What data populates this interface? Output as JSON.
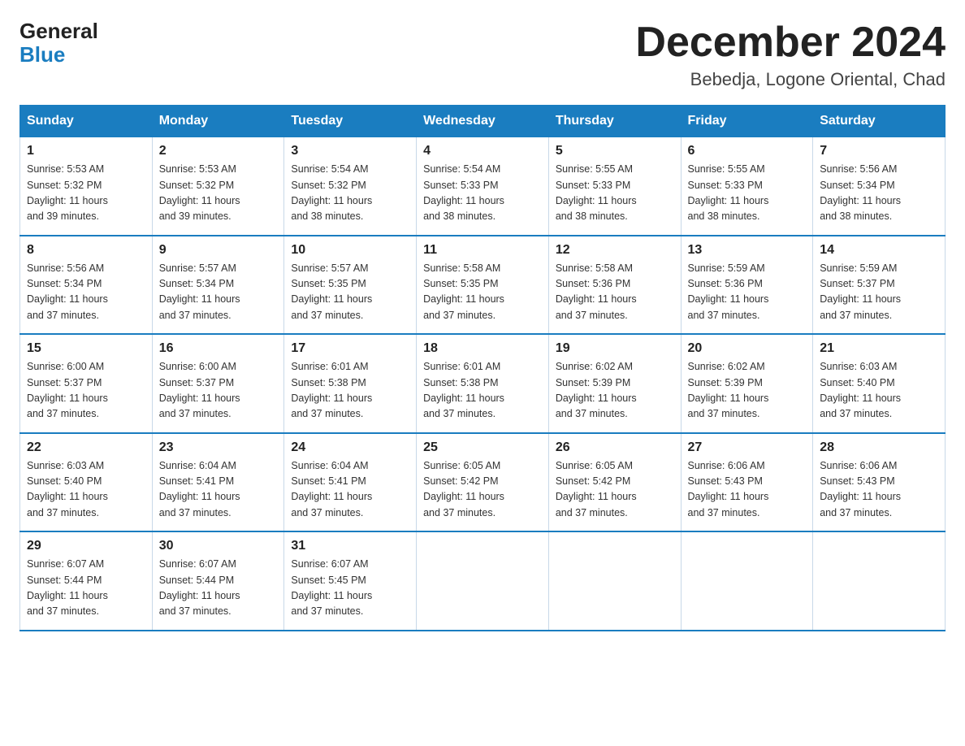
{
  "header": {
    "logo_general": "General",
    "logo_blue": "Blue",
    "month_title": "December 2024",
    "location": "Bebedja, Logone Oriental, Chad"
  },
  "weekdays": [
    "Sunday",
    "Monday",
    "Tuesday",
    "Wednesday",
    "Thursday",
    "Friday",
    "Saturday"
  ],
  "weeks": [
    [
      {
        "day": "1",
        "sunrise": "5:53 AM",
        "sunset": "5:32 PM",
        "daylight": "11 hours and 39 minutes."
      },
      {
        "day": "2",
        "sunrise": "5:53 AM",
        "sunset": "5:32 PM",
        "daylight": "11 hours and 39 minutes."
      },
      {
        "day": "3",
        "sunrise": "5:54 AM",
        "sunset": "5:32 PM",
        "daylight": "11 hours and 38 minutes."
      },
      {
        "day": "4",
        "sunrise": "5:54 AM",
        "sunset": "5:33 PM",
        "daylight": "11 hours and 38 minutes."
      },
      {
        "day": "5",
        "sunrise": "5:55 AM",
        "sunset": "5:33 PM",
        "daylight": "11 hours and 38 minutes."
      },
      {
        "day": "6",
        "sunrise": "5:55 AM",
        "sunset": "5:33 PM",
        "daylight": "11 hours and 38 minutes."
      },
      {
        "day": "7",
        "sunrise": "5:56 AM",
        "sunset": "5:34 PM",
        "daylight": "11 hours and 38 minutes."
      }
    ],
    [
      {
        "day": "8",
        "sunrise": "5:56 AM",
        "sunset": "5:34 PM",
        "daylight": "11 hours and 37 minutes."
      },
      {
        "day": "9",
        "sunrise": "5:57 AM",
        "sunset": "5:34 PM",
        "daylight": "11 hours and 37 minutes."
      },
      {
        "day": "10",
        "sunrise": "5:57 AM",
        "sunset": "5:35 PM",
        "daylight": "11 hours and 37 minutes."
      },
      {
        "day": "11",
        "sunrise": "5:58 AM",
        "sunset": "5:35 PM",
        "daylight": "11 hours and 37 minutes."
      },
      {
        "day": "12",
        "sunrise": "5:58 AM",
        "sunset": "5:36 PM",
        "daylight": "11 hours and 37 minutes."
      },
      {
        "day": "13",
        "sunrise": "5:59 AM",
        "sunset": "5:36 PM",
        "daylight": "11 hours and 37 minutes."
      },
      {
        "day": "14",
        "sunrise": "5:59 AM",
        "sunset": "5:37 PM",
        "daylight": "11 hours and 37 minutes."
      }
    ],
    [
      {
        "day": "15",
        "sunrise": "6:00 AM",
        "sunset": "5:37 PM",
        "daylight": "11 hours and 37 minutes."
      },
      {
        "day": "16",
        "sunrise": "6:00 AM",
        "sunset": "5:37 PM",
        "daylight": "11 hours and 37 minutes."
      },
      {
        "day": "17",
        "sunrise": "6:01 AM",
        "sunset": "5:38 PM",
        "daylight": "11 hours and 37 minutes."
      },
      {
        "day": "18",
        "sunrise": "6:01 AM",
        "sunset": "5:38 PM",
        "daylight": "11 hours and 37 minutes."
      },
      {
        "day": "19",
        "sunrise": "6:02 AM",
        "sunset": "5:39 PM",
        "daylight": "11 hours and 37 minutes."
      },
      {
        "day": "20",
        "sunrise": "6:02 AM",
        "sunset": "5:39 PM",
        "daylight": "11 hours and 37 minutes."
      },
      {
        "day": "21",
        "sunrise": "6:03 AM",
        "sunset": "5:40 PM",
        "daylight": "11 hours and 37 minutes."
      }
    ],
    [
      {
        "day": "22",
        "sunrise": "6:03 AM",
        "sunset": "5:40 PM",
        "daylight": "11 hours and 37 minutes."
      },
      {
        "day": "23",
        "sunrise": "6:04 AM",
        "sunset": "5:41 PM",
        "daylight": "11 hours and 37 minutes."
      },
      {
        "day": "24",
        "sunrise": "6:04 AM",
        "sunset": "5:41 PM",
        "daylight": "11 hours and 37 minutes."
      },
      {
        "day": "25",
        "sunrise": "6:05 AM",
        "sunset": "5:42 PM",
        "daylight": "11 hours and 37 minutes."
      },
      {
        "day": "26",
        "sunrise": "6:05 AM",
        "sunset": "5:42 PM",
        "daylight": "11 hours and 37 minutes."
      },
      {
        "day": "27",
        "sunrise": "6:06 AM",
        "sunset": "5:43 PM",
        "daylight": "11 hours and 37 minutes."
      },
      {
        "day": "28",
        "sunrise": "6:06 AM",
        "sunset": "5:43 PM",
        "daylight": "11 hours and 37 minutes."
      }
    ],
    [
      {
        "day": "29",
        "sunrise": "6:07 AM",
        "sunset": "5:44 PM",
        "daylight": "11 hours and 37 minutes."
      },
      {
        "day": "30",
        "sunrise": "6:07 AM",
        "sunset": "5:44 PM",
        "daylight": "11 hours and 37 minutes."
      },
      {
        "day": "31",
        "sunrise": "6:07 AM",
        "sunset": "5:45 PM",
        "daylight": "11 hours and 37 minutes."
      },
      null,
      null,
      null,
      null
    ]
  ],
  "labels": {
    "sunrise": "Sunrise:",
    "sunset": "Sunset:",
    "daylight": "Daylight:"
  }
}
